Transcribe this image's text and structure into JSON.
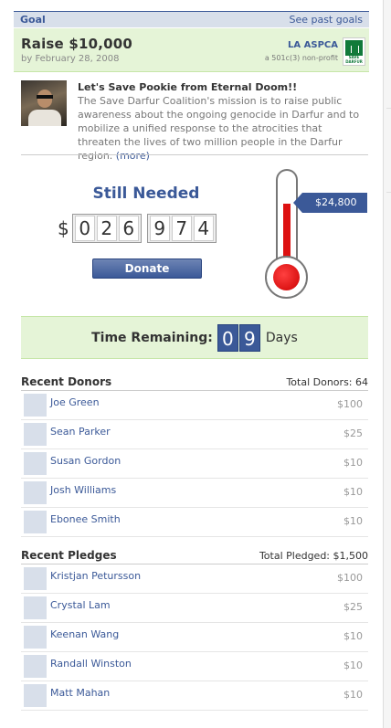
{
  "header": {
    "title": "Goal",
    "link": "See past goals"
  },
  "goal": {
    "amount": "Raise $10,000",
    "date": "by February 28, 2008",
    "org_name": "LA ASPCA",
    "org_type": "a 501c(3) non-profit",
    "logo_text": "SAVE DARFUR"
  },
  "story": {
    "headline": "Let's Save Pookie from Eternal Doom!!",
    "body": "The Save Darfur Coalition's mission is to raise public awareness about the ongoing genocide in Darfur and to mobilize a unified response to the atrocities that threaten the lives of two million people in the Darfur region.",
    "more": "(more)"
  },
  "still_needed": {
    "label": "Still Needed",
    "currency": "$",
    "digits": [
      "0",
      "2",
      "6",
      "9",
      "7",
      "4"
    ],
    "button": "Donate"
  },
  "thermometer": {
    "raised_label": "$24,800"
  },
  "time_remaining": {
    "label": "Time Remaining:",
    "digits": [
      "0",
      "9"
    ],
    "unit": "Days"
  },
  "donors": {
    "title": "Recent Donors",
    "total": "Total Donors: 64",
    "items": [
      {
        "name": "Joe Green",
        "amount": "$100"
      },
      {
        "name": "Sean Parker",
        "amount": "$25"
      },
      {
        "name": "Susan Gordon",
        "amount": "$10"
      },
      {
        "name": "Josh Williams",
        "amount": "$10"
      },
      {
        "name": "Ebonee Smith",
        "amount": "$10"
      }
    ]
  },
  "pledges": {
    "title": "Recent Pledges",
    "total": "Total Pledged: $1,500",
    "items": [
      {
        "name": "Kristjan Petursson",
        "amount": "$100"
      },
      {
        "name": "Crystal Lam",
        "amount": "$25"
      },
      {
        "name": "Keenan Wang",
        "amount": "$10"
      },
      {
        "name": "Randall Winston",
        "amount": "$10"
      },
      {
        "name": "Matt Mahan",
        "amount": "$10"
      }
    ]
  },
  "colors": {
    "accent": "#3b5998",
    "green_bg": "#e5f4d7",
    "mercury": "#dd1111"
  }
}
